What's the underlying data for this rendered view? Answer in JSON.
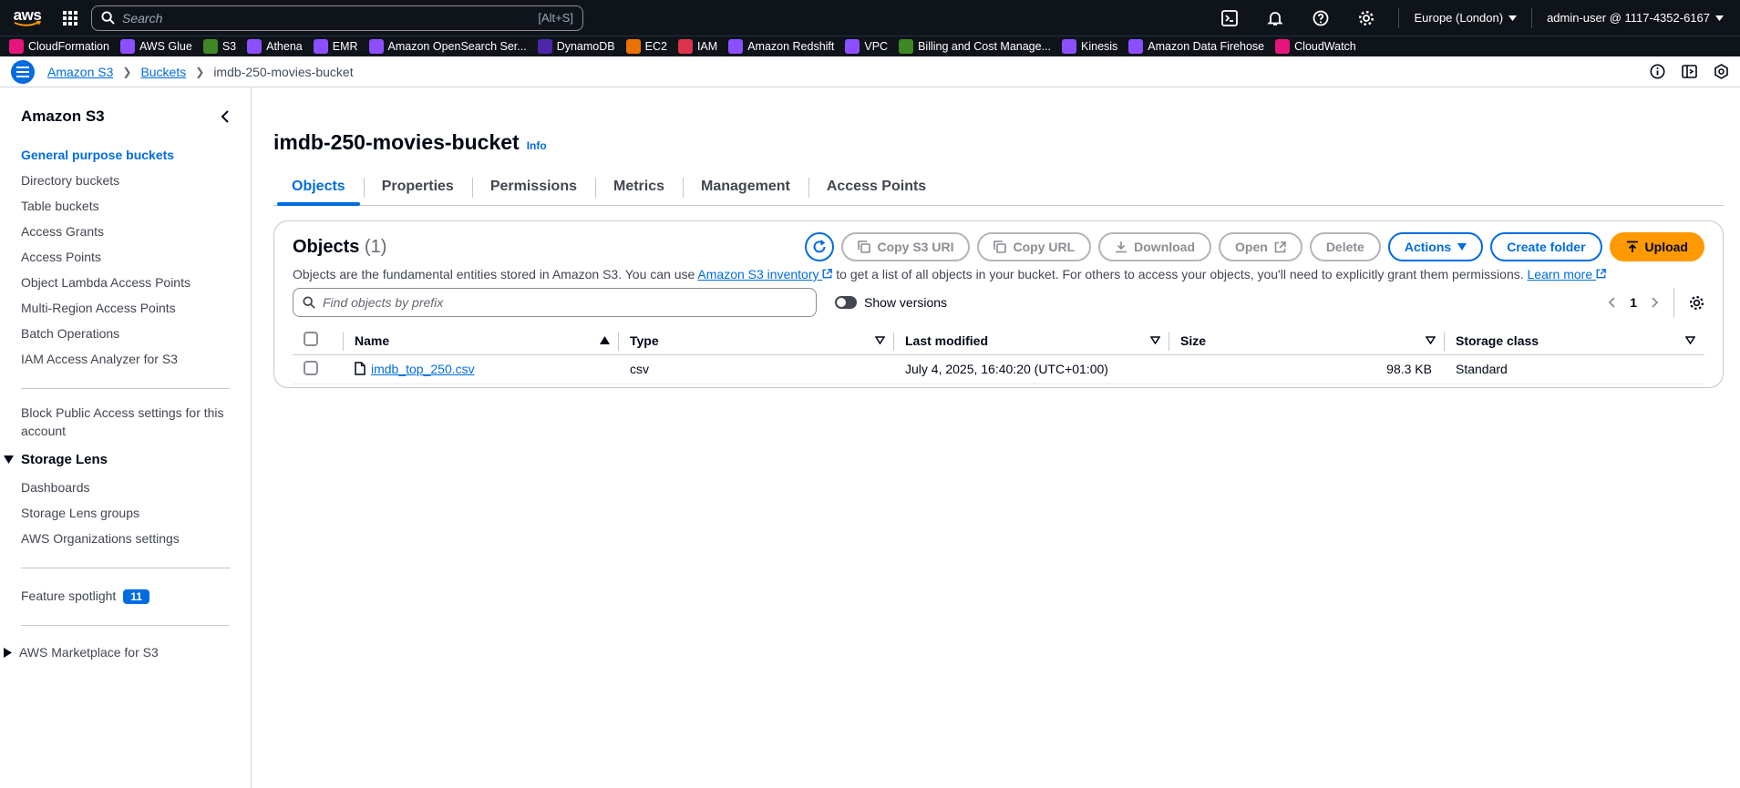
{
  "topbar": {
    "logo_text": "aws",
    "search_placeholder": "Search",
    "search_shortcut": "[Alt+S]",
    "region": "Europe (London)",
    "account": "admin-user @ 1117-4352-6167"
  },
  "favorites": [
    {
      "label": "CloudFormation",
      "color": "#e7157b"
    },
    {
      "label": "AWS Glue",
      "color": "#8c4fff"
    },
    {
      "label": "S3",
      "color": "#3f8624"
    },
    {
      "label": "Athena",
      "color": "#8c4fff"
    },
    {
      "label": "EMR",
      "color": "#8c4fff"
    },
    {
      "label": "Amazon OpenSearch Ser...",
      "color": "#8c4fff"
    },
    {
      "label": "DynamoDB",
      "color": "#4d27aa"
    },
    {
      "label": "EC2",
      "color": "#ed7100"
    },
    {
      "label": "IAM",
      "color": "#dd344c"
    },
    {
      "label": "Amazon Redshift",
      "color": "#8c4fff"
    },
    {
      "label": "VPC",
      "color": "#8c4fff"
    },
    {
      "label": "Billing and Cost Manage...",
      "color": "#3f8624"
    },
    {
      "label": "Kinesis",
      "color": "#8c4fff"
    },
    {
      "label": "Amazon Data Firehose",
      "color": "#8c4fff"
    },
    {
      "label": "CloudWatch",
      "color": "#e7157b"
    }
  ],
  "breadcrumb": {
    "items": [
      "Amazon S3",
      "Buckets"
    ],
    "current": "imdb-250-movies-bucket"
  },
  "sidebar": {
    "title": "Amazon S3",
    "items": [
      "General purpose buckets",
      "Directory buckets",
      "Table buckets",
      "Access Grants",
      "Access Points",
      "Object Lambda Access Points",
      "Multi-Region Access Points",
      "Batch Operations",
      "IAM Access Analyzer for S3"
    ],
    "block_public": "Block Public Access settings for this account",
    "storage_lens": {
      "title": "Storage Lens",
      "items": [
        "Dashboards",
        "Storage Lens groups",
        "AWS Organizations settings"
      ]
    },
    "feature_spotlight": "Feature spotlight",
    "feature_badge": "11",
    "marketplace": "AWS Marketplace for S3"
  },
  "main": {
    "bucket_name": "imdb-250-movies-bucket",
    "info": "Info",
    "tabs": [
      "Objects",
      "Properties",
      "Permissions",
      "Metrics",
      "Management",
      "Access Points"
    ],
    "objects": {
      "title": "Objects",
      "count": "(1)",
      "buttons": {
        "copy_uri": "Copy S3 URI",
        "copy_url": "Copy URL",
        "download": "Download",
        "open": "Open",
        "delete": "Delete",
        "actions": "Actions",
        "create_folder": "Create folder",
        "upload": "Upload"
      },
      "desc_pre": "Objects are the fundamental entities stored in Amazon S3. You can use ",
      "desc_link": "Amazon S3 inventory",
      "desc_mid": " to get a list of all objects in your bucket. For others to access your objects, you'll need to explicitly grant them permissions. ",
      "desc_learn": "Learn more",
      "filter_placeholder": "Find objects by prefix",
      "show_versions": "Show versions",
      "page": "1",
      "columns": [
        "Name",
        "Type",
        "Last modified",
        "Size",
        "Storage class"
      ],
      "rows": [
        {
          "name": "imdb_top_250.csv",
          "type": "csv",
          "modified": "July 4, 2025, 16:40:20 (UTC+01:00)",
          "size": "98.3 KB",
          "storage": "Standard"
        }
      ]
    }
  }
}
